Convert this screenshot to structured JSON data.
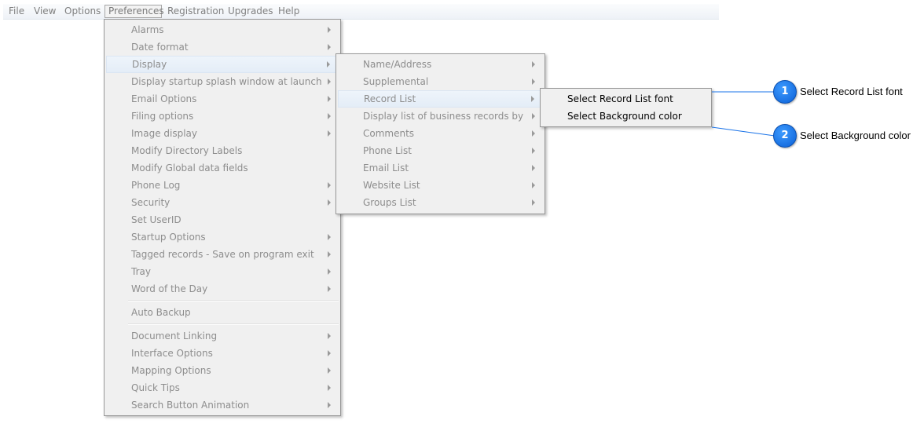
{
  "menubar": {
    "items": [
      "File",
      "View",
      "Options",
      "Preferences",
      "Registration",
      "Upgrades",
      "Help"
    ]
  },
  "preferences_menu": {
    "items": [
      {
        "label": "Alarms",
        "submenu": true
      },
      {
        "label": "Date format",
        "submenu": true
      },
      {
        "label": "Display",
        "submenu": true,
        "highlighted": true
      },
      {
        "label": "Display startup splash window at launch",
        "submenu": true
      },
      {
        "label": "Email Options",
        "submenu": true
      },
      {
        "label": "Filing options",
        "submenu": true
      },
      {
        "label": "Image display",
        "submenu": true
      },
      {
        "label": "Modify Directory Labels",
        "submenu": false
      },
      {
        "label": "Modify Global data fields",
        "submenu": false
      },
      {
        "label": "Phone Log",
        "submenu": true
      },
      {
        "label": "Security",
        "submenu": true
      },
      {
        "label": "Set UserID",
        "submenu": false
      },
      {
        "label": "Startup Options",
        "submenu": true
      },
      {
        "label": "Tagged records - Save on program exit",
        "submenu": true
      },
      {
        "label": "Tray",
        "submenu": true
      },
      {
        "label": "Word of the Day",
        "submenu": true
      },
      {
        "label": "Auto Backup",
        "submenu": false
      },
      {
        "label": "Document Linking",
        "submenu": true
      },
      {
        "label": "Interface Options",
        "submenu": true
      },
      {
        "label": "Mapping Options",
        "submenu": true
      },
      {
        "label": "Quick Tips",
        "submenu": true
      },
      {
        "label": "Search Button Animation",
        "submenu": true
      }
    ]
  },
  "display_menu": {
    "items": [
      {
        "label": "Name/Address",
        "submenu": true
      },
      {
        "label": "Supplemental",
        "submenu": true
      },
      {
        "label": "Record List",
        "submenu": true,
        "highlighted": true
      },
      {
        "label": "Display list of business records by",
        "submenu": true
      },
      {
        "label": "Comments",
        "submenu": true
      },
      {
        "label": "Phone List",
        "submenu": true
      },
      {
        "label": "Email List",
        "submenu": true
      },
      {
        "label": "Website List",
        "submenu": true
      },
      {
        "label": "Groups List",
        "submenu": true
      }
    ]
  },
  "record_list_menu": {
    "items": [
      {
        "label": "Select Record List font"
      },
      {
        "label": "Select Background color"
      }
    ]
  },
  "callouts": [
    {
      "number": "1",
      "text": "Select Record List font"
    },
    {
      "number": "2",
      "text": "Select Background color"
    }
  ],
  "colors": {
    "badge": "#1a73e8",
    "connector": "#1a73e8",
    "menu_bg": "#f0f0f0",
    "disabled_text": "#8d8d8d"
  }
}
